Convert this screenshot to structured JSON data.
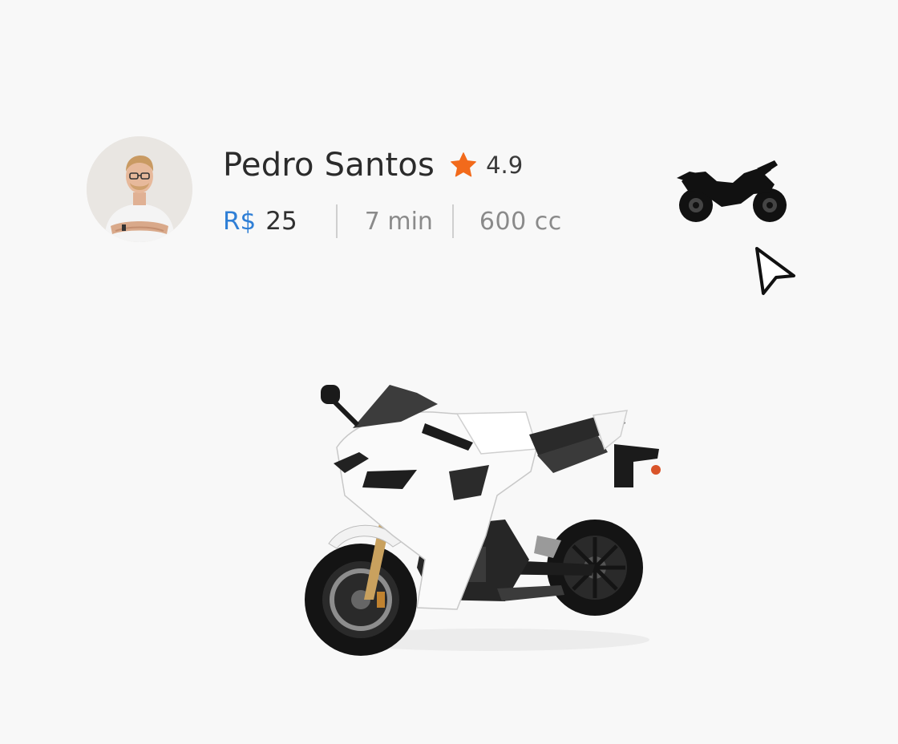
{
  "driver": {
    "name": "Pedro Santos",
    "rating": "4.9",
    "avatar_icon": "person-avatar"
  },
  "trip": {
    "currency": "R$",
    "price": "25",
    "eta": "7 min",
    "engine": "600 cc"
  },
  "icons": {
    "rating_star": "star-icon",
    "vehicle_type": "motorcycle-icon",
    "pointer": "cursor-icon"
  },
  "colors": {
    "background": "#f8f8f8",
    "currency_accent": "#2f7fd6",
    "star": "#f26a1b",
    "primary_text": "#2b2b2b",
    "secondary_text": "#8a8a8a"
  }
}
